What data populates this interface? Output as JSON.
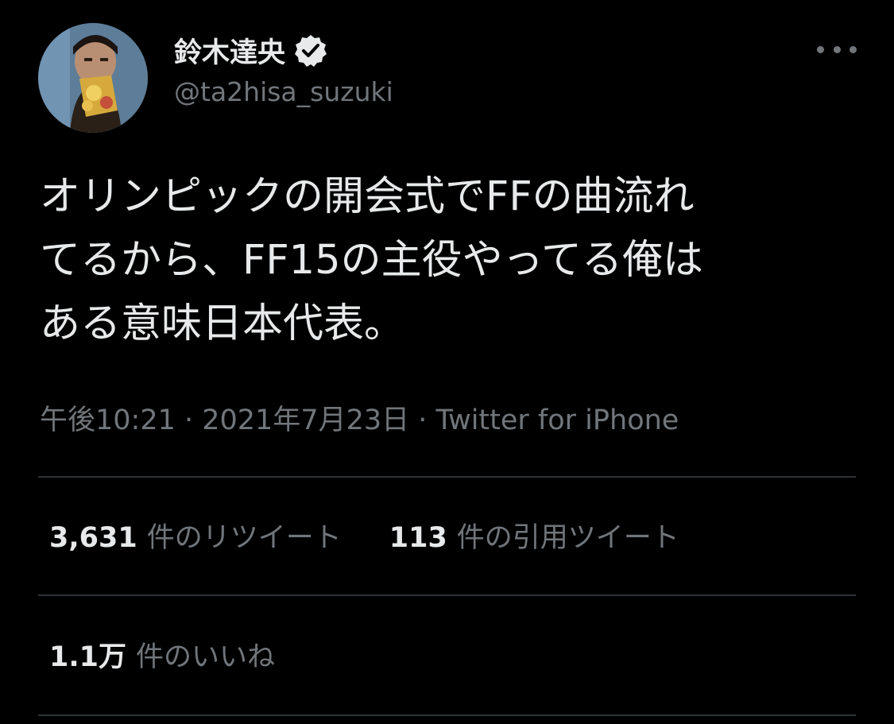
{
  "author": {
    "display_name": "鈴木達央",
    "handle": "@ta2hisa_suzuki",
    "verified_icon": "verified-badge-icon"
  },
  "tweet": {
    "text": "オリンピックの開会式でFFの曲流れ\nてるから、FF15の主役やってる俺は\nある意味日本代表。",
    "meta": "午後10:21 · 2021年7月23日 · Twitter for iPhone"
  },
  "stats": {
    "retweets_count": "3,631",
    "retweets_label": "件のリツイート",
    "quotes_count": "113",
    "quotes_label": "件の引用ツイート",
    "likes_count": "1.1万",
    "likes_label": "件のいいね"
  },
  "colors": {
    "background": "#000000",
    "primary_text": "#e7e9ea",
    "secondary_text": "#71767b",
    "divider": "#2f3336"
  }
}
